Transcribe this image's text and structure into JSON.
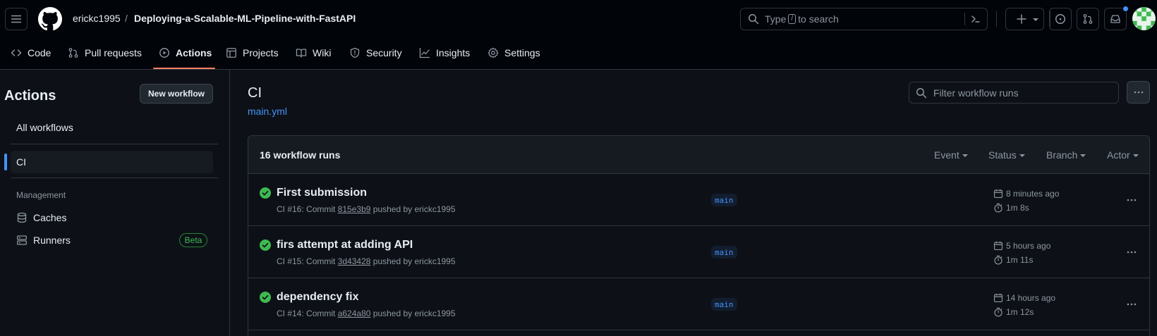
{
  "header": {
    "owner": "erickc1995",
    "separator": "/",
    "repo": "Deploying-a-Scalable-ML-Pipeline-with-FastAPI",
    "search": {
      "before": "Type",
      "key": "/",
      "after": "to search"
    },
    "colors": {
      "bg": "#010409",
      "accent_underline": "#f78166",
      "notification_dot": "#4493f8"
    }
  },
  "tabs": [
    {
      "label": "Code",
      "icon": "code-icon"
    },
    {
      "label": "Pull requests",
      "icon": "git-pull-request-icon"
    },
    {
      "label": "Actions",
      "icon": "play-icon",
      "active": true
    },
    {
      "label": "Projects",
      "icon": "table-icon"
    },
    {
      "label": "Wiki",
      "icon": "book-icon"
    },
    {
      "label": "Security",
      "icon": "shield-icon"
    },
    {
      "label": "Insights",
      "icon": "graph-icon"
    },
    {
      "label": "Settings",
      "icon": "gear-icon"
    }
  ],
  "sidebar": {
    "title": "Actions",
    "new_workflow": "New workflow",
    "all_workflows": "All workflows",
    "workflows": [
      {
        "label": "CI",
        "active": true
      }
    ],
    "management_heading": "Management",
    "management": [
      {
        "label": "Caches",
        "icon": "database-icon"
      },
      {
        "label": "Runners",
        "icon": "server-icon",
        "badge": "Beta"
      }
    ]
  },
  "main": {
    "title": "CI",
    "file": "main.yml",
    "filter_placeholder": "Filter workflow runs",
    "runs_count": "16 workflow runs",
    "filters": [
      "Event",
      "Status",
      "Branch",
      "Actor"
    ],
    "runs": [
      {
        "title": "First submission",
        "prefix": "CI #16: Commit",
        "sha": "815e3b9",
        "suffix": "pushed by erickc1995",
        "branch": "main",
        "when": "8 minutes ago",
        "duration": "1m 8s",
        "status": "success"
      },
      {
        "title": "firs attempt at adding API",
        "prefix": "CI #15: Commit",
        "sha": "3d43428",
        "suffix": "pushed by erickc1995",
        "branch": "main",
        "when": "5 hours ago",
        "duration": "1m 11s",
        "status": "success"
      },
      {
        "title": "dependency fix",
        "prefix": "CI #14: Commit",
        "sha": "a624a80",
        "suffix": "pushed by erickc1995",
        "branch": "main",
        "when": "14 hours ago",
        "duration": "1m 12s",
        "status": "success"
      }
    ]
  }
}
